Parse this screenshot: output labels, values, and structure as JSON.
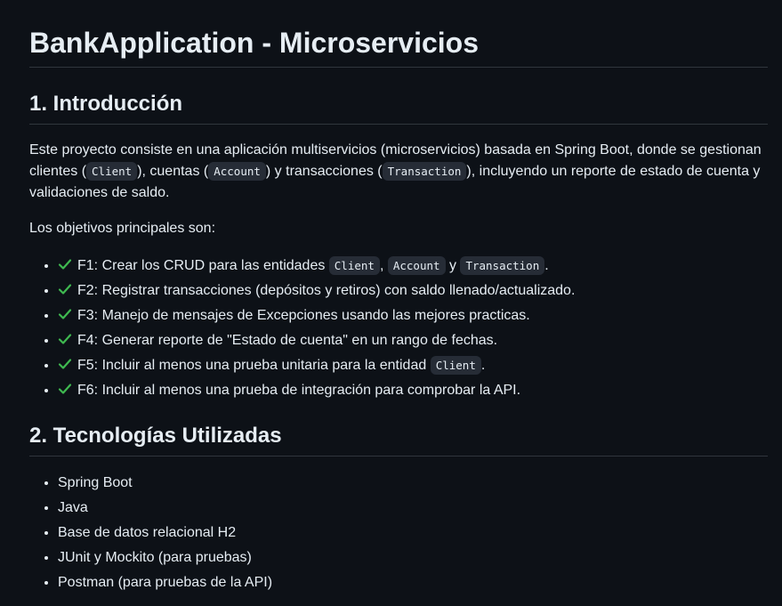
{
  "title": "BankApplication - Microservicios",
  "intro": {
    "heading": "1. Introducción",
    "p1": {
      "t1": "Este proyecto consiste en una aplicación multiservicios (microservicios) basada en Spring Boot, donde se gestionan clientes (",
      "c1": "Client",
      "t2": "), cuentas (",
      "c2": "Account",
      "t3": ") y transacciones (",
      "c3": "Transaction",
      "t4": "), incluyendo un reporte de estado de cuenta y validaciones de saldo."
    },
    "p2": "Los objetivos principales son:",
    "objectives": [
      {
        "text": "F1: Crear los CRUD para las entidades ",
        "c1": "Client",
        "s1": ",",
        "c2": "Account",
        "s2": "y",
        "c3": "Transaction",
        "end": "."
      },
      {
        "text": "F2: Registrar transacciones (depósitos y retiros) con saldo llenado/actualizado."
      },
      {
        "text": "F3: Manejo de mensajes de Excepciones usando las mejores practicas."
      },
      {
        "text": "F4: Generar reporte de \"Estado de cuenta\" en un rango de fechas."
      },
      {
        "text": "F5: Incluir al menos una prueba unitaria para la entidad ",
        "c1": "Client",
        "end": "."
      },
      {
        "text": "F6: Incluir al menos una prueba de integración para comprobar la API."
      }
    ],
    "check_icon": "check-mark-icon",
    "check_color": "#3fb950"
  },
  "tech": {
    "heading": "2. Tecnologías Utilizadas",
    "items": [
      "Spring Boot",
      "Java",
      "Base de datos relacional H2",
      "JUnit y Mockito (para pruebas)",
      "Postman (para pruebas de la API)"
    ]
  },
  "colors": {
    "background": "#0d1117",
    "text": "#e6edf3",
    "border": "#30363d",
    "code_bg": "#262c36"
  }
}
